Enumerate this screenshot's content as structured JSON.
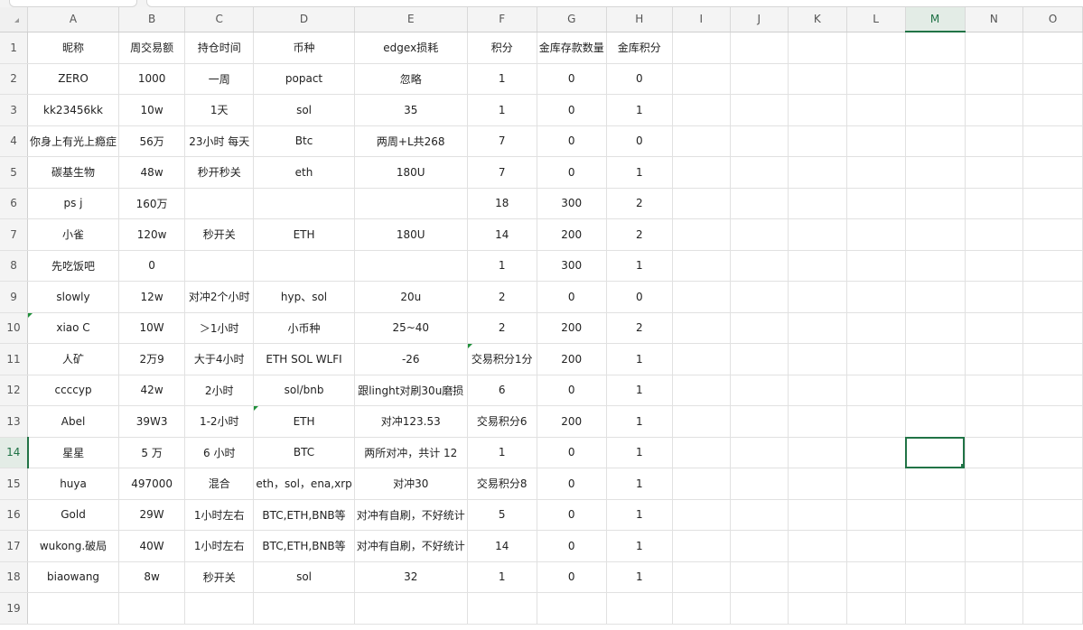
{
  "sheet": {
    "columns": [
      "A",
      "B",
      "C",
      "D",
      "E",
      "F",
      "G",
      "H",
      "I",
      "J",
      "K",
      "L",
      "M",
      "N",
      "O"
    ],
    "selected_column": "M",
    "selected_row": "14",
    "rows": [
      {
        "n": "1",
        "cells": [
          "昵称",
          "周交易额",
          "持仓时间",
          "币种",
          "edgex损耗",
          "积分",
          "金库存款数量",
          "金库积分"
        ]
      },
      {
        "n": "2",
        "cells": [
          "ZERO",
          "1000",
          "一周",
          "popact",
          "忽略",
          "1",
          "0",
          "0"
        ]
      },
      {
        "n": "3",
        "cells": [
          "kk23456kk",
          "10w",
          "1天",
          "sol",
          "35",
          "1",
          "0",
          "1"
        ]
      },
      {
        "n": "4",
        "cells": [
          "你身上有光上瘾症",
          "56万",
          "23小时 每天",
          "Btc",
          "两周+L共268",
          "7",
          "0",
          "0"
        ]
      },
      {
        "n": "5",
        "cells": [
          "碳基生物",
          "48w",
          "秒开秒关",
          "eth",
          "180U",
          "7",
          "0",
          "1"
        ]
      },
      {
        "n": "6",
        "cells": [
          "ps j",
          "160万",
          "",
          "",
          "",
          "18",
          "300",
          "2"
        ]
      },
      {
        "n": "7",
        "cells": [
          "小雀",
          "120w",
          "秒开关",
          "ETH",
          "180U",
          "14",
          "200",
          "2"
        ]
      },
      {
        "n": "8",
        "cells": [
          "先吃饭吧",
          "0",
          "",
          "",
          "",
          "1",
          "300",
          "1"
        ]
      },
      {
        "n": "9",
        "cells": [
          "slowly",
          "12w",
          "对冲2个小时",
          "hyp、sol",
          "20u",
          "2",
          "0",
          "0"
        ]
      },
      {
        "n": "10",
        "cells": [
          "xiao C",
          "10W",
          "＞1小时",
          "小币种",
          "25~40",
          "2",
          "200",
          "2"
        ]
      },
      {
        "n": "11",
        "cells": [
          "人矿",
          "2万9",
          "大于4小时",
          "ETH SOL WLFI",
          "-26",
          "交易积分1分",
          "200",
          "1"
        ]
      },
      {
        "n": "12",
        "cells": [
          "ccccyp",
          "42w",
          "2小时",
          "sol/bnb",
          "跟linght对刷30u磨损",
          "6",
          "0",
          "1"
        ]
      },
      {
        "n": "13",
        "cells": [
          "Abel",
          "39W3",
          "1-2小时",
          "ETH",
          "对冲123.53",
          "交易积分6",
          "200",
          "1"
        ]
      },
      {
        "n": "14",
        "cells": [
          "星星",
          "5 万",
          "6 小时",
          "BTC",
          "两所对冲，共计 12",
          "1",
          "0",
          "1"
        ]
      },
      {
        "n": "15",
        "cells": [
          "huya",
          "497000",
          "混合",
          "eth，sol，ena,xrp",
          "对冲30",
          "交易积分8",
          "0",
          "1"
        ]
      },
      {
        "n": "16",
        "cells": [
          "Gold",
          "29W",
          "1小时左右",
          "BTC,ETH,BNB等",
          "对冲有自刷，不好统计",
          "5",
          "0",
          "1"
        ]
      },
      {
        "n": "17",
        "cells": [
          "wukong.破局",
          "40W",
          "1小时左右",
          "BTC,ETH,BNB等",
          "对冲有自刷，不好统计",
          "14",
          "0",
          "1"
        ]
      },
      {
        "n": "18",
        "cells": [
          "biaowang",
          "8w",
          "秒开关",
          "sol",
          "32",
          "1",
          "0",
          "1"
        ]
      },
      {
        "n": "19",
        "cells": []
      }
    ]
  },
  "colors": {
    "accent": "#217346",
    "comment_marker": "#1f8f3a",
    "header_bg": "#f4f4f4"
  }
}
